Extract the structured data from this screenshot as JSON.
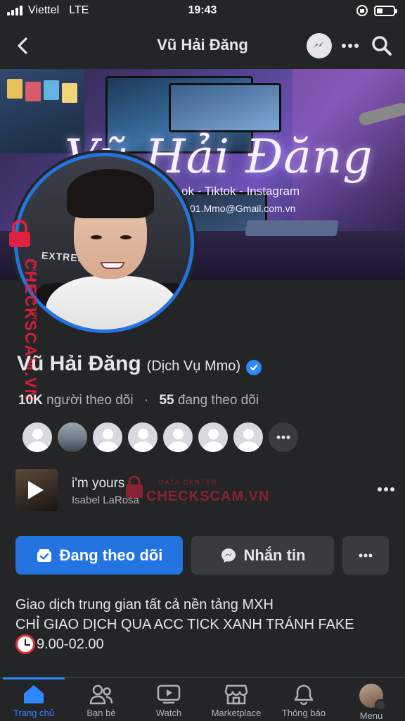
{
  "status_bar": {
    "carrier": "Viettel",
    "network": "LTE",
    "time": "19:43"
  },
  "nav": {
    "title": "Vũ Hải Đăng"
  },
  "cover": {
    "signature": "Vũ Hải Đăng",
    "tagline": "ok - Tiktok - Instagram",
    "email": "01.Mmo@Gmail.com.vn",
    "chair_text": "EXTREME"
  },
  "watermark": {
    "brand": "CHECKSCAM.VN",
    "sub": "DATA CENTER"
  },
  "profile": {
    "name": "Vũ Hải Đăng",
    "subtitle": "(Dịch Vụ Mmo)",
    "followers_count": "10K",
    "followers_label": "người theo dõi",
    "following_count": "55",
    "following_label": "đang theo dõi"
  },
  "music": {
    "song": "i'm yours",
    "artist": "Isabel LaRosa"
  },
  "actions": {
    "follow_label": "Đang theo dõi",
    "message_label": "Nhắn tin"
  },
  "bio": {
    "line1": "Giao dịch trung gian tất cả nền tảng MXH",
    "line2": "CHỈ GIAO DỊCH QUA ACC TICK XANH TRÁNH FAKE",
    "hours": "9.00-02.00"
  },
  "tabs": [
    {
      "label": "Trang chủ",
      "icon": "home-icon",
      "active": true
    },
    {
      "label": "Bạn bè",
      "icon": "friends-icon"
    },
    {
      "label": "Watch",
      "icon": "watch-icon"
    },
    {
      "label": "Marketplace",
      "icon": "marketplace-icon"
    },
    {
      "label": "Thông báo",
      "icon": "bell-icon"
    },
    {
      "label": "Menu",
      "icon": "menu-avatar"
    }
  ],
  "colors": {
    "accent": "#2374e1",
    "background": "#242526",
    "secondary_button": "#3a3b3c",
    "watermark": "#e02040"
  }
}
